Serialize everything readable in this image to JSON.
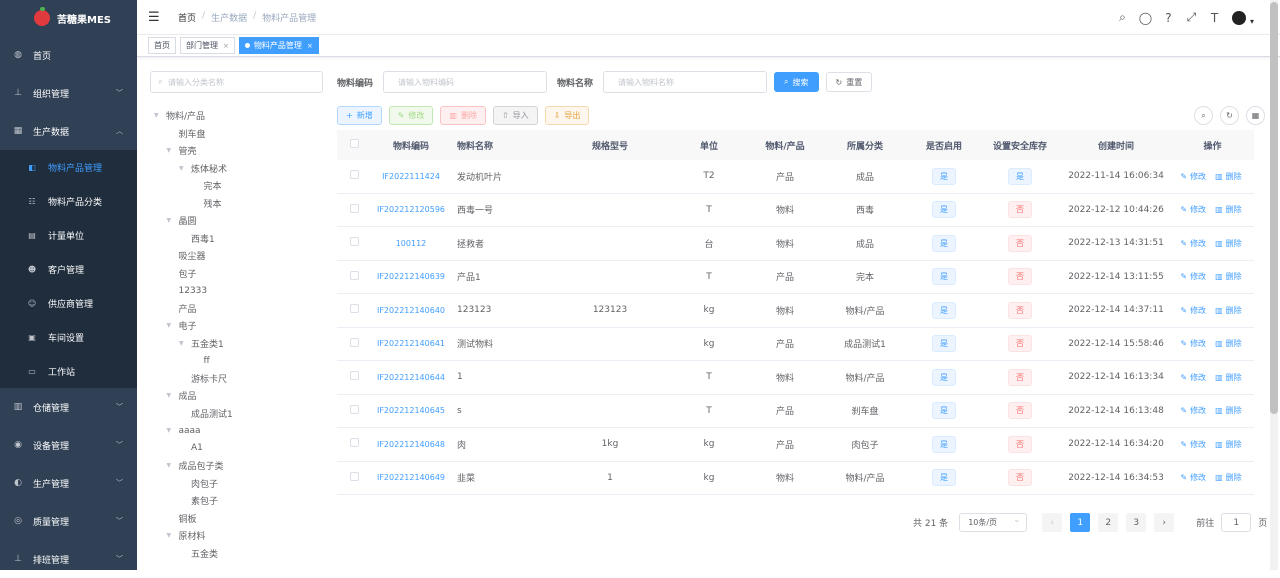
{
  "app": {
    "title": "苦糖果MES"
  },
  "sidebar": {
    "items": [
      {
        "label": "首页",
        "icon": "dashboard-icon",
        "glyph": "◍",
        "expandable": false
      },
      {
        "label": "组织管理",
        "icon": "tree-icon",
        "glyph": "⊥",
        "expandable": true
      },
      {
        "label": "生产数据",
        "icon": "table-icon",
        "glyph": "▦",
        "expandable": true,
        "expanded": true
      }
    ],
    "sub_items": [
      {
        "label": "物料产品管理",
        "icon": "box-icon",
        "glyph": "◧",
        "active": true
      },
      {
        "label": "物料产品分类",
        "icon": "list-icon",
        "glyph": "☷",
        "active": false
      },
      {
        "label": "计量单位",
        "icon": "calendar-icon",
        "glyph": "▤",
        "active": false
      },
      {
        "label": "客户管理",
        "icon": "user-icon",
        "glyph": "☻",
        "active": false
      },
      {
        "label": "供应商管理",
        "icon": "people-icon",
        "glyph": "☺",
        "active": false
      },
      {
        "label": "车间设置",
        "icon": "monitor-icon",
        "glyph": "▣",
        "active": false
      },
      {
        "label": "工作站",
        "icon": "clipboard-icon",
        "glyph": "▭",
        "active": false
      }
    ],
    "more_items": [
      {
        "label": "仓储管理",
        "icon": "warehouse-icon",
        "glyph": "▥"
      },
      {
        "label": "设备管理",
        "icon": "device-icon",
        "glyph": "◉"
      },
      {
        "label": "生产管理",
        "icon": "eye-icon",
        "glyph": "◐"
      },
      {
        "label": "质量管理",
        "icon": "quality-icon",
        "glyph": "◎"
      },
      {
        "label": "排班管理",
        "icon": "schedule-icon",
        "glyph": "⊥"
      }
    ]
  },
  "navbar": {
    "breadcrumb": [
      "首页",
      "生产数据",
      "物料产品管理"
    ],
    "separator": "/",
    "icons": [
      {
        "name": "search-icon",
        "glyph": "⌕"
      },
      {
        "name": "github-icon",
        "glyph": "◯"
      },
      {
        "name": "question-icon",
        "glyph": "?"
      },
      {
        "name": "fullscreen-icon",
        "glyph": "⤢"
      },
      {
        "name": "font-size-icon",
        "glyph": "T"
      }
    ]
  },
  "tags": [
    {
      "label": "首页",
      "closable": false,
      "active": false
    },
    {
      "label": "部门管理",
      "closable": true,
      "active": false
    },
    {
      "label": "物料产品管理",
      "closable": true,
      "active": true
    }
  ],
  "tree": {
    "search_placeholder": "请输入分类名称",
    "nodes": [
      {
        "label": "物料/产品",
        "level": 0,
        "caret": true
      },
      {
        "label": "刹车盘",
        "level": 1,
        "caret": false
      },
      {
        "label": "管壳",
        "level": 1,
        "caret": true
      },
      {
        "label": "炼体秘术",
        "level": 2,
        "caret": true
      },
      {
        "label": "完本",
        "level": 3,
        "caret": false
      },
      {
        "label": "残本",
        "level": 3,
        "caret": false
      },
      {
        "label": "晶圆",
        "level": 1,
        "caret": true
      },
      {
        "label": "西毒1",
        "level": 2,
        "caret": false
      },
      {
        "label": "吸尘器",
        "level": 1,
        "caret": false
      },
      {
        "label": "包子",
        "level": 1,
        "caret": false
      },
      {
        "label": "12333",
        "level": 1,
        "caret": false
      },
      {
        "label": "产品",
        "level": 1,
        "caret": false
      },
      {
        "label": "电子",
        "level": 1,
        "caret": true
      },
      {
        "label": "五金类1",
        "level": 2,
        "caret": true
      },
      {
        "label": "ff",
        "level": 3,
        "caret": false
      },
      {
        "label": "游标卡尺",
        "level": 2,
        "caret": false
      },
      {
        "label": "成品",
        "level": 1,
        "caret": true
      },
      {
        "label": "成品测试1",
        "level": 2,
        "caret": false
      },
      {
        "label": "aaaa",
        "level": 1,
        "caret": true
      },
      {
        "label": "A1",
        "level": 2,
        "caret": false
      },
      {
        "label": "成品包子类",
        "level": 1,
        "caret": true
      },
      {
        "label": "肉包子",
        "level": 2,
        "caret": false
      },
      {
        "label": "素包子",
        "level": 2,
        "caret": false
      },
      {
        "label": "铜板",
        "level": 1,
        "caret": false
      },
      {
        "label": "原材料",
        "level": 1,
        "caret": true
      },
      {
        "label": "五金类",
        "level": 2,
        "caret": false
      }
    ]
  },
  "filters": {
    "code_label": "物料编码",
    "code_placeholder": "请输入物料编码",
    "name_label": "物料名称",
    "name_placeholder": "请输入物料名称",
    "search_label": "搜索",
    "reset_label": "重置"
  },
  "toolbar": {
    "new_label": "新增",
    "edit_label": "修改",
    "delete_label": "删除",
    "import_label": "导入",
    "export_label": "导出"
  },
  "table": {
    "columns": [
      "物料编码",
      "物料名称",
      "规格型号",
      "单位",
      "物料/产品",
      "所属分类",
      "是否启用",
      "设置安全库存",
      "创建时间",
      "操作"
    ],
    "rows": [
      {
        "code": "IF2022111424",
        "name": "发动机叶片",
        "spec": "",
        "unit": "T2",
        "type": "产品",
        "category": "成品",
        "enabled": "是",
        "safe_stock": "是",
        "created": "2022-11-14 16:06:34"
      },
      {
        "code": "IF202212120596",
        "name": "西毒一号",
        "spec": "",
        "unit": "T",
        "type": "物料",
        "category": "西毒",
        "enabled": "是",
        "safe_stock": "否",
        "created": "2022-12-12 10:44:26"
      },
      {
        "code": "100112",
        "name": "拯救者",
        "spec": "",
        "unit": "台",
        "type": "物料",
        "category": "成品",
        "enabled": "是",
        "safe_stock": "否",
        "created": "2022-12-13 14:31:51"
      },
      {
        "code": "IF202212140639",
        "name": "产品1",
        "spec": "",
        "unit": "T",
        "type": "产品",
        "category": "完本",
        "enabled": "是",
        "safe_stock": "否",
        "created": "2022-12-14 13:11:55"
      },
      {
        "code": "IF202212140640",
        "name": "123123",
        "spec": "123123",
        "unit": "kg",
        "type": "物料",
        "category": "物料/产品",
        "enabled": "是",
        "safe_stock": "否",
        "created": "2022-12-14 14:37:11"
      },
      {
        "code": "IF202212140641",
        "name": "测试物料",
        "spec": "",
        "unit": "kg",
        "type": "产品",
        "category": "成品测试1",
        "enabled": "是",
        "safe_stock": "否",
        "created": "2022-12-14 15:58:46"
      },
      {
        "code": "IF202212140644",
        "name": "1",
        "spec": "",
        "unit": "T",
        "type": "物料",
        "category": "物料/产品",
        "enabled": "是",
        "safe_stock": "否",
        "created": "2022-12-14 16:13:34"
      },
      {
        "code": "IF202212140645",
        "name": "s",
        "spec": "",
        "unit": "T",
        "type": "产品",
        "category": "刹车盘",
        "enabled": "是",
        "safe_stock": "否",
        "created": "2022-12-14 16:13:48"
      },
      {
        "code": "IF202212140648",
        "name": "肉",
        "spec": "1kg",
        "unit": "kg",
        "type": "产品",
        "category": "肉包子",
        "enabled": "是",
        "safe_stock": "否",
        "created": "2022-12-14 16:34:20"
      },
      {
        "code": "IF202212140649",
        "name": "韭菜",
        "spec": "1",
        "unit": "kg",
        "type": "物料",
        "category": "物料/产品",
        "enabled": "是",
        "safe_stock": "否",
        "created": "2022-12-14 16:34:53"
      }
    ],
    "edit_label": "修改",
    "delete_label": "删除"
  },
  "pagination": {
    "total_text": "共 21 条",
    "page_size": "10条/页",
    "pages": [
      "1",
      "2",
      "3"
    ],
    "current": "1",
    "goto_label": "前往",
    "goto_value": "1",
    "page_suffix": "页"
  },
  "colors": {
    "primary": "#409eff",
    "sidebar_bg": "#304156",
    "submenu_bg": "#1f2d3d",
    "danger": "#f56c6c"
  }
}
